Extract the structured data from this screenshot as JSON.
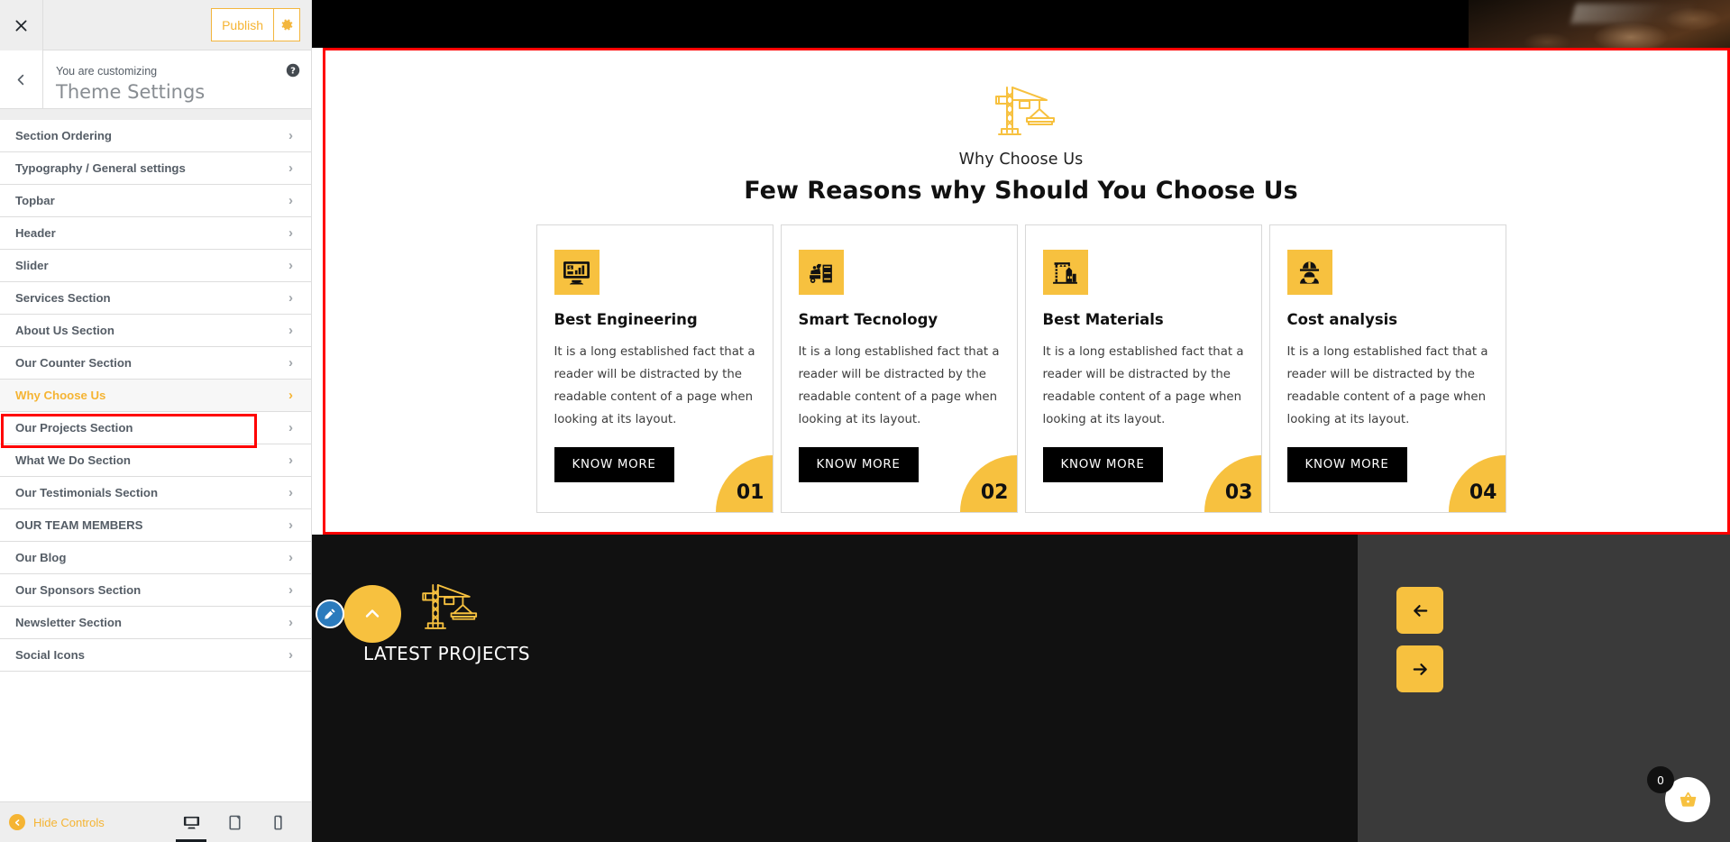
{
  "customizer": {
    "close_icon": "close-icon",
    "publish_label": "Publish",
    "gear_icon": "gear-icon",
    "back_icon": "chevron-left-icon",
    "eyebrow": "You are customizing",
    "title": "Theme Settings",
    "help_icon": "help-icon",
    "items": [
      {
        "label": "Section Ordering",
        "selected": false
      },
      {
        "label": "Typography / General settings",
        "selected": false
      },
      {
        "label": "Topbar",
        "selected": false
      },
      {
        "label": "Header",
        "selected": false
      },
      {
        "label": "Slider",
        "selected": false
      },
      {
        "label": "Services Section",
        "selected": false
      },
      {
        "label": "About Us Section",
        "selected": false
      },
      {
        "label": "Our Counter Section",
        "selected": false
      },
      {
        "label": "Why Choose Us",
        "selected": true
      },
      {
        "label": "Our Projects Section",
        "selected": false
      },
      {
        "label": "What We Do Section",
        "selected": false
      },
      {
        "label": "Our Testimonials Section",
        "selected": false
      },
      {
        "label": "OUR TEAM MEMBERS",
        "selected": false
      },
      {
        "label": "Our Blog",
        "selected": false
      },
      {
        "label": "Our Sponsors Section",
        "selected": false
      },
      {
        "label": "Newsletter Section",
        "selected": false
      },
      {
        "label": "Social Icons",
        "selected": false
      }
    ],
    "chevron": "›",
    "footer": {
      "hide_controls_label": "Hide Controls",
      "hide_icon": "collapse-arrow-icon",
      "devices": [
        {
          "name": "desktop-icon",
          "active": true
        },
        {
          "name": "tablet-icon",
          "active": false
        },
        {
          "name": "mobile-icon",
          "active": false
        }
      ]
    }
  },
  "preview": {
    "why_choose_us": {
      "crane_icon": "crane-icon",
      "eyebrow": "Why Choose Us",
      "title": "Few Reasons why Should You Choose Us",
      "cards": [
        {
          "icon": "monitor-chart-icon",
          "title": "Best Engineering",
          "text": "It is a long established fact that a reader will be distracted by the readable content of a page when looking at its layout.",
          "button_label": "KNOW MORE",
          "number": "01"
        },
        {
          "icon": "dump-truck-icon",
          "title": "Smart Tecnology",
          "text": "It is a long established fact that a reader will be distracted by the readable content of a page when looking at its layout.",
          "button_label": "KNOW MORE",
          "number": "02"
        },
        {
          "icon": "crane-factory-icon",
          "title": "Best Materials",
          "text": "It is a long established fact that a reader will be distracted by the readable content of a page when looking at its layout.",
          "button_label": "KNOW MORE",
          "number": "03"
        },
        {
          "icon": "worker-helmet-icon",
          "title": "Cost analysis",
          "text": "It is a long established fact that a reader will be distracted by the readable content of a page when looking at its layout.",
          "button_label": "KNOW MORE",
          "number": "04"
        }
      ]
    },
    "latest_projects": {
      "crane_icon": "crane-icon",
      "title": "LATEST PROJECTS",
      "prev_icon": "arrow-left-icon",
      "next_icon": "arrow-right-icon"
    },
    "edit_pencil_icon": "edit-pencil-icon",
    "scroll_top_icon": "chevron-up-icon",
    "cart": {
      "icon": "shopping-basket-icon",
      "count": "0"
    }
  },
  "colors": {
    "accent_gold": "#f7c13f",
    "customizer_accent": "#f5b433",
    "selection_red": "#ff0000",
    "dark": "#111111",
    "panel_dark": "#3a3a3a",
    "edit_blue": "#2b7bbd"
  }
}
